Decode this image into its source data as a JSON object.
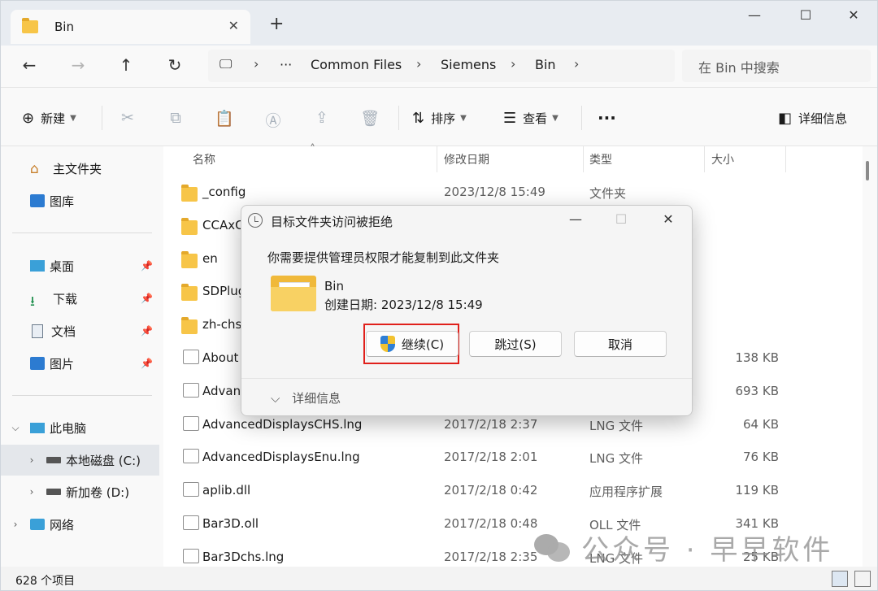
{
  "tab": {
    "title": "Bin"
  },
  "breadcrumb": {
    "more": "···",
    "items": [
      "Common Files",
      "Siemens",
      "Bin"
    ]
  },
  "search": {
    "placeholder": "在 Bin 中搜索"
  },
  "commands": {
    "new_label": "新建",
    "sort_label": "排序",
    "view_label": "查看",
    "more": "···",
    "details_label": "详细信息"
  },
  "sidebar": {
    "home": "主文件夹",
    "gallery": "图库",
    "desktop": "桌面",
    "downloads": "下载",
    "documents": "文档",
    "pictures": "图片",
    "thispc": "此电脑",
    "drive_c": "本地磁盘 (C:)",
    "drive_d": "新加卷 (D:)",
    "network": "网络"
  },
  "columns": {
    "name": "名称",
    "modified": "修改日期",
    "type": "类型",
    "size": "大小"
  },
  "files": [
    {
      "name": "_config",
      "date": "2023/12/8 15:49",
      "type": "文件夹",
      "size": "",
      "kind": "folder"
    },
    {
      "name": "CCAxC",
      "date": "",
      "type": "",
      "size": "",
      "kind": "folder"
    },
    {
      "name": "en",
      "date": "",
      "type": "",
      "size": "",
      "kind": "folder"
    },
    {
      "name": "SDPlug",
      "date": "",
      "type": "",
      "size": "",
      "kind": "folder"
    },
    {
      "name": "zh-chs",
      "date": "",
      "type": "",
      "size": "",
      "kind": "folder"
    },
    {
      "name": "About",
      "date": "",
      "type": "",
      "size": "138 KB",
      "kind": "file"
    },
    {
      "name": "Advan",
      "date": "",
      "type": "",
      "size": "693 KB",
      "kind": "file"
    },
    {
      "name": "AdvancedDisplaysCHS.lng",
      "date": "2017/2/18 2:37",
      "type": "LNG 文件",
      "size": "64 KB",
      "kind": "file"
    },
    {
      "name": "AdvancedDisplaysEnu.lng",
      "date": "2017/2/18 2:01",
      "type": "LNG 文件",
      "size": "76 KB",
      "kind": "file"
    },
    {
      "name": "aplib.dll",
      "date": "2017/2/18 0:42",
      "type": "应用程序扩展",
      "size": "119 KB",
      "kind": "file"
    },
    {
      "name": "Bar3D.oll",
      "date": "2017/2/18 0:48",
      "type": "OLL 文件",
      "size": "341 KB",
      "kind": "file"
    },
    {
      "name": "Bar3Dchs.lng",
      "date": "2017/2/18 2:35",
      "type": "LNG 文件",
      "size": "25 KB",
      "kind": "file"
    }
  ],
  "status": {
    "count": "628 个项目"
  },
  "dialog": {
    "title": "目标文件夹访问被拒绝",
    "message": "你需要提供管理员权限才能复制到此文件夹",
    "folder_name": "Bin",
    "folder_created": "创建日期: 2023/12/8 15:49",
    "continue_label": "继续(C)",
    "skip_label": "跳过(S)",
    "cancel_label": "取消",
    "more_label": "详细信息"
  },
  "watermark": {
    "text": "公众号 · 早早软件"
  },
  "colors": {
    "highlight": "#e0201b",
    "folder": "#f7c548",
    "accent": "#0067c0"
  }
}
